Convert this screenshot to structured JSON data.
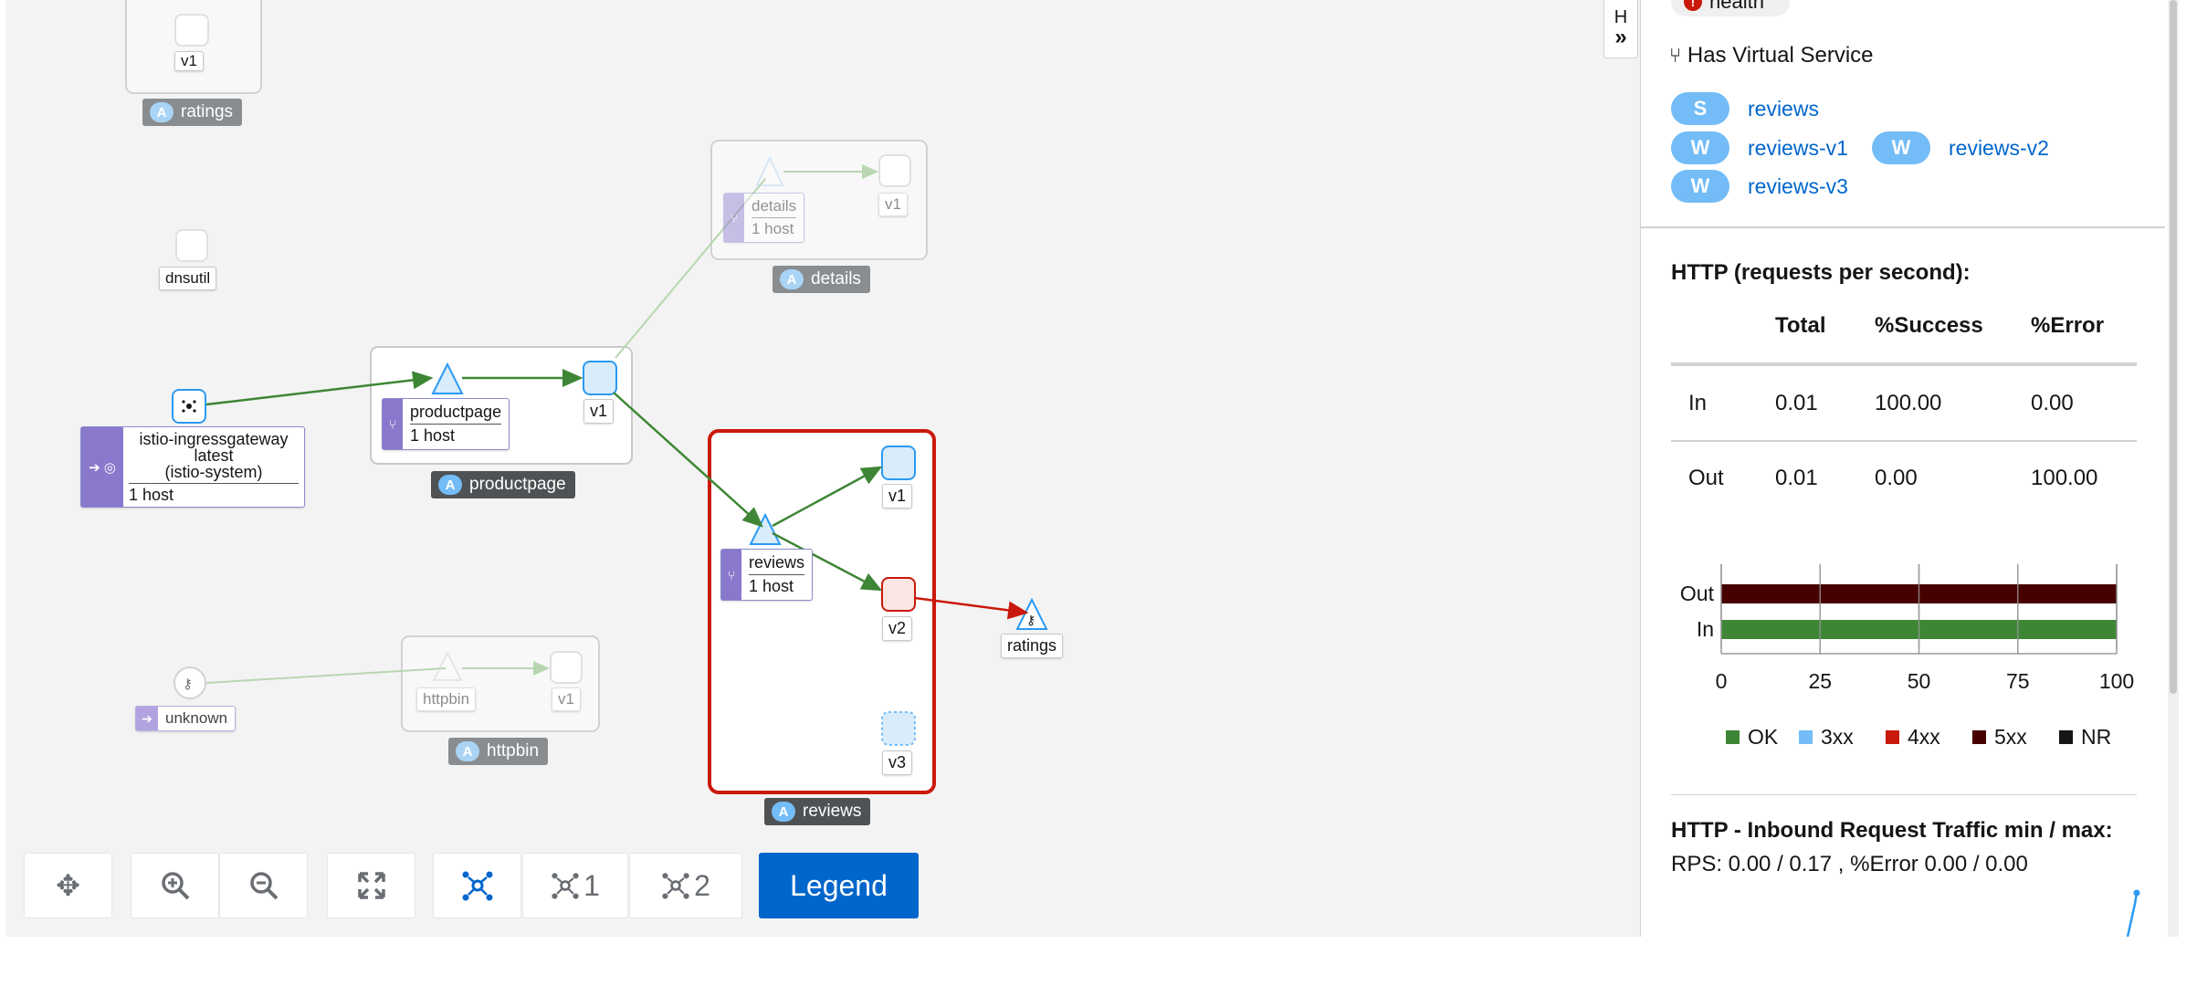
{
  "graph": {
    "nodes": {
      "ratings_top_version": "v1",
      "ratings_app_label": "ratings",
      "dnsutil": "dnsutil",
      "details_service": "details",
      "details_hosts": "1 host",
      "details_version": "v1",
      "details_app_label": "details",
      "gateway_name": "istio-ingressgateway",
      "gateway_version": "latest",
      "gateway_namespace": "(istio-system)",
      "gateway_hosts": "1 host",
      "productpage_service": "productpage",
      "productpage_hosts": "1 host",
      "productpage_version": "v1",
      "productpage_app_label": "productpage",
      "reviews_service": "reviews",
      "reviews_hosts": "1 host",
      "reviews_v1": "v1",
      "reviews_v2": "v2",
      "reviews_v3": "v3",
      "reviews_app_label": "reviews",
      "ratings_service": "ratings",
      "unknown": "unknown",
      "httpbin_service": "httpbin",
      "httpbin_version": "v1",
      "httpbin_app_label": "httpbin",
      "app_badge": "A"
    },
    "colors": {
      "edge_ok": "#3e8635",
      "edge_error": "#c9190b",
      "edge_dim": "#b8d6b1",
      "selected_box": "#c9190b",
      "service_strip": "#8a78cc"
    }
  },
  "toolbar": {
    "pan_icon": "pan-icon",
    "zoom_in_icon": "zoom-in-icon",
    "zoom_out_icon": "zoom-out-icon",
    "fit_icon": "fit-icon",
    "layout_default_icon": "layout-default-icon",
    "layout1_label": "1",
    "layout2_label": "2",
    "legend_label": "Legend"
  },
  "side_panel": {
    "hide_label": "H",
    "health_label": "health",
    "virtual_service_label": "Has Virtual Service",
    "service_badge": "S",
    "workload_badge": "W",
    "service_link": "reviews",
    "workloads": [
      "reviews-v1",
      "reviews-v2",
      "reviews-v3"
    ],
    "http_title": "HTTP (requests per second):",
    "table": {
      "headers": [
        "",
        "Total",
        "%Success",
        "%Error"
      ],
      "rows": [
        [
          "In",
          "0.01",
          "100.00",
          "0.00"
        ],
        [
          "Out",
          "0.01",
          "0.00",
          "100.00"
        ]
      ]
    },
    "inbound_title": "HTTP - Inbound Request Traffic min / max:",
    "inbound_stats": "RPS: 0.00 / 0.17 , %Error 0.00 / 0.00"
  },
  "chart_data": {
    "type": "bar",
    "orientation": "horizontal",
    "stacked": true,
    "categories": [
      "Out",
      "In"
    ],
    "series": [
      {
        "name": "OK",
        "color": "#3e8635",
        "values": [
          0,
          100
        ]
      },
      {
        "name": "3xx",
        "color": "#73bcf7",
        "values": [
          0,
          0
        ]
      },
      {
        "name": "4xx",
        "color": "#c9190b",
        "values": [
          0,
          0
        ]
      },
      {
        "name": "5xx",
        "color": "#470000",
        "values": [
          100,
          0
        ]
      },
      {
        "name": "NR",
        "color": "#151515",
        "values": [
          0,
          0
        ]
      }
    ],
    "xticks": [
      "0",
      "25",
      "50",
      "75",
      "100"
    ],
    "xlim": [
      0,
      100
    ],
    "grid": true,
    "legend_position": "bottom"
  }
}
